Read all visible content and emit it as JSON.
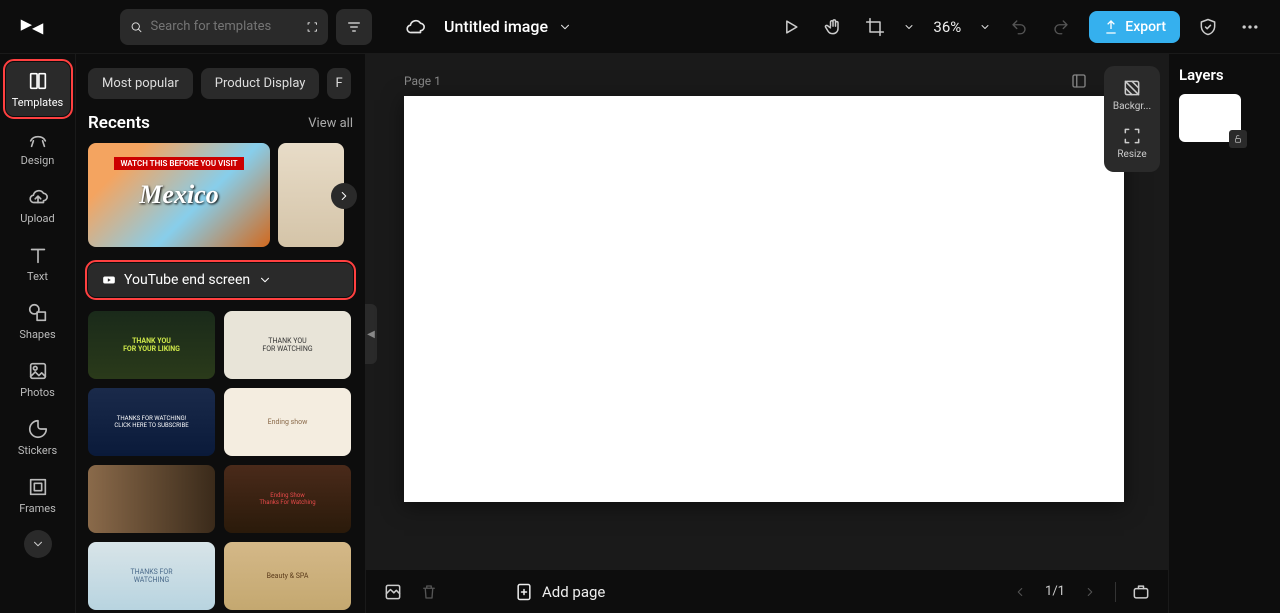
{
  "app": {
    "logo": "CapCut"
  },
  "header": {
    "search_placeholder": "Search for templates",
    "doc_title": "Untitled image",
    "zoom": "36%",
    "export_label": "Export"
  },
  "nav": {
    "items": [
      {
        "id": "templates",
        "label": "Templates",
        "active": true,
        "highlight": true
      },
      {
        "id": "design",
        "label": "Design"
      },
      {
        "id": "upload",
        "label": "Upload"
      },
      {
        "id": "text",
        "label": "Text"
      },
      {
        "id": "shapes",
        "label": "Shapes"
      },
      {
        "id": "photos",
        "label": "Photos"
      },
      {
        "id": "stickers",
        "label": "Stickers"
      },
      {
        "id": "frames",
        "label": "Frames"
      }
    ]
  },
  "panel": {
    "chips": [
      "Most popular",
      "Product Display",
      "F"
    ],
    "recents_title": "Recents",
    "view_all": "View all",
    "recent_banner": "WATCH THIS BEFORE YOU VISIT",
    "recent_title": "Mexico",
    "category_label": "YouTube end screen"
  },
  "canvas": {
    "page_label": "Page 1",
    "side_tools": [
      {
        "id": "background",
        "label": "Backgr..."
      },
      {
        "id": "resize",
        "label": "Resize"
      }
    ]
  },
  "bottombar": {
    "add_page": "Add page",
    "page_indicator": "1/1"
  },
  "layers": {
    "title": "Layers"
  },
  "colors": {
    "accent": "#35b0ee",
    "highlight": "#ff4040"
  }
}
